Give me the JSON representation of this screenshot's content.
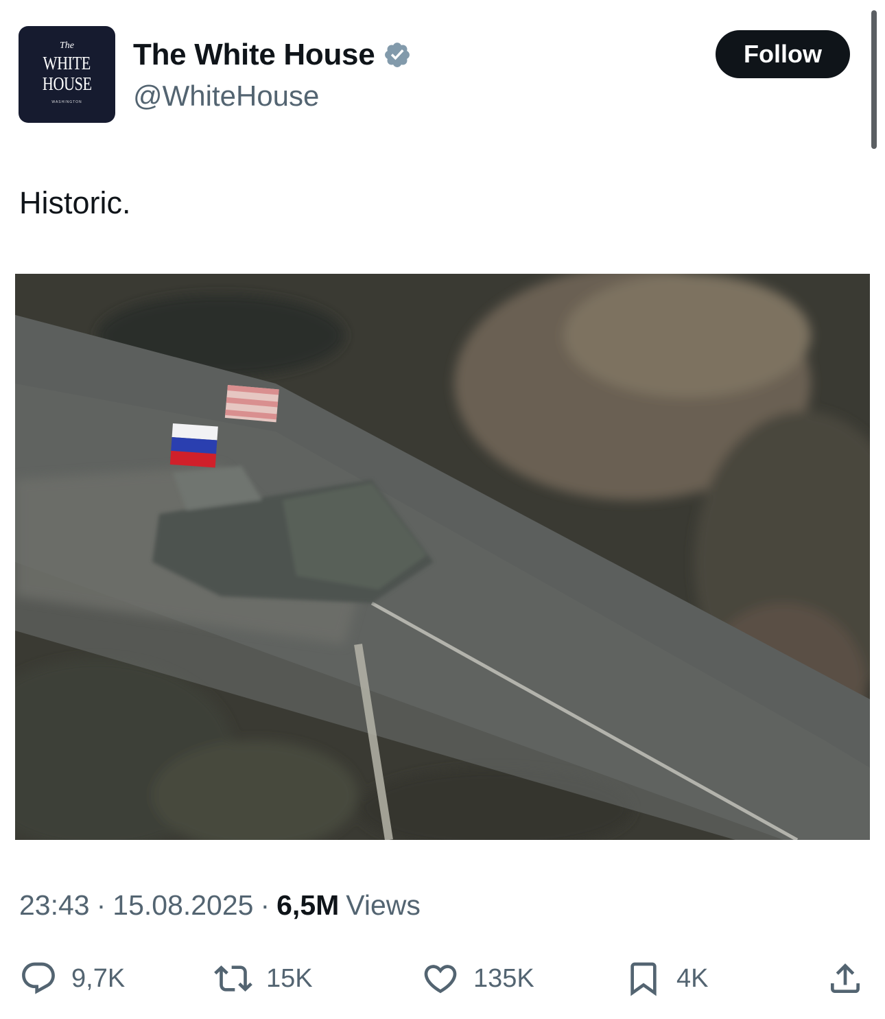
{
  "author": {
    "avatar": {
      "top_text": "The",
      "line1": "WHITE",
      "line2": "HOUSE",
      "sub_text": "WASHINGTON"
    },
    "display_name": "The White House",
    "handle": "@WhiteHouse",
    "verified_color": "#829aab"
  },
  "follow_label": "Follow",
  "tweet": {
    "text": "Historic."
  },
  "media": {
    "type": "video-still",
    "description_icon": "video-frame"
  },
  "meta": {
    "time": "23:43",
    "date": "15.08.2025",
    "separator": "·",
    "views_count": "6,5M",
    "views_label": "Views"
  },
  "actions": {
    "replies": "9,7K",
    "reposts": "15K",
    "likes": "135K",
    "bookmarks": "4K"
  },
  "colors": {
    "text": "#0f1419",
    "secondary": "#536471",
    "follow_bg": "#0f1419"
  }
}
